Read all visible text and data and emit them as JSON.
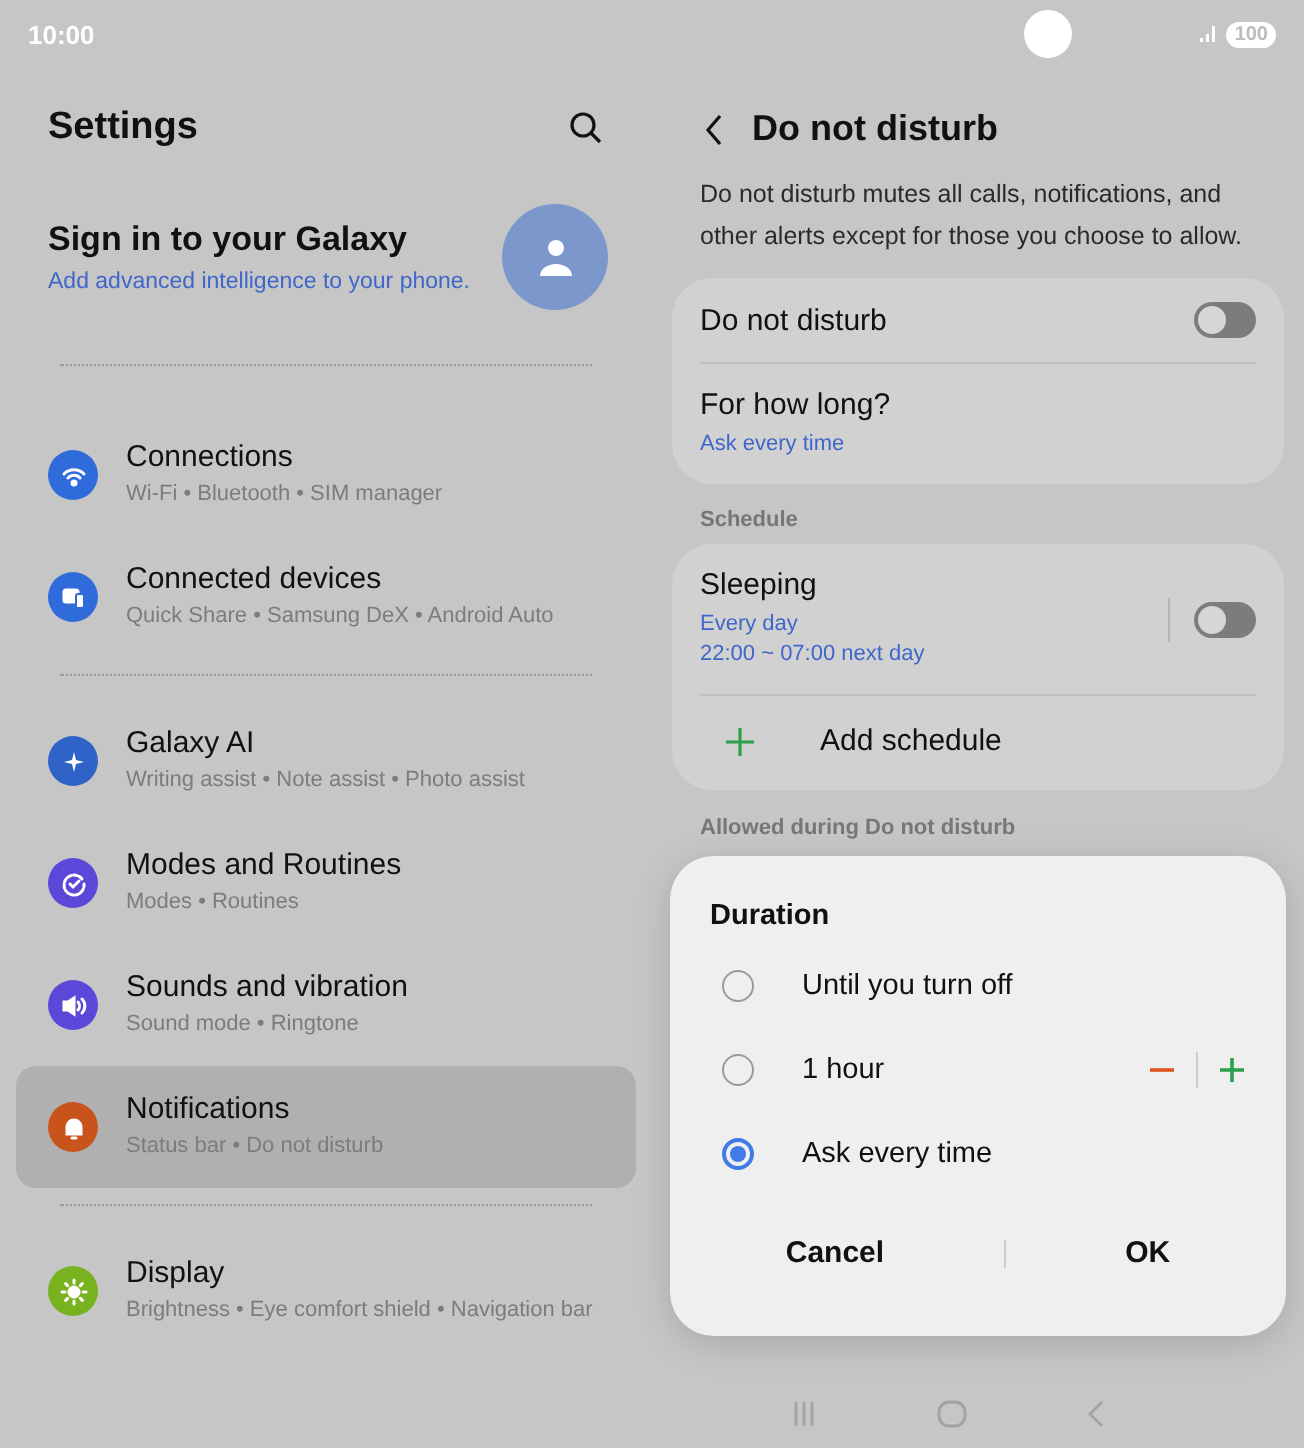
{
  "status_bar": {
    "time": "10:00",
    "battery": "100"
  },
  "settings": {
    "title": "Settings",
    "profile": {
      "title": "Sign in to your Galaxy",
      "subtitle": "Add advanced intelligence to your phone."
    },
    "groups": [
      {
        "items": [
          {
            "title": "Connections",
            "subtitle": "Wi-Fi • Bluetooth • SIM manager",
            "color": "#2f6bdb",
            "selected": false
          },
          {
            "title": "Connected devices",
            "subtitle": "Quick Share • Samsung DeX • Android Auto",
            "color": "#2f6bdb",
            "selected": false
          }
        ]
      },
      {
        "items": [
          {
            "title": "Galaxy AI",
            "subtitle": "Writing assist • Note assist • Photo assist",
            "color": "#2f63c8",
            "selected": false
          },
          {
            "title": "Modes and Routines",
            "subtitle": "Modes • Routines",
            "color": "#5b48d9",
            "selected": false
          },
          {
            "title": "Sounds and vibration",
            "subtitle": "Sound mode • Ringtone",
            "color": "#5b48d9",
            "selected": false
          },
          {
            "title": "Notifications",
            "subtitle": "Status bar • Do not disturb",
            "color": "#c9541b",
            "selected": true
          }
        ]
      },
      {
        "items": [
          {
            "title": "Display",
            "subtitle": "Brightness • Eye comfort shield • Navigation bar",
            "color": "#79b21f",
            "selected": false
          }
        ]
      }
    ]
  },
  "dnd": {
    "title": "Do not disturb",
    "description": "Do not disturb mutes all calls, notifications, and other alerts except for those you choose to allow.",
    "main_card": [
      {
        "kind": "toggle",
        "title": "Do not disturb",
        "on": false
      },
      {
        "kind": "detail",
        "title": "For how long?",
        "value": "Ask every time"
      }
    ],
    "schedule_label": "Schedule",
    "schedule_card": [
      {
        "kind": "schedule",
        "title": "Sleeping",
        "lines": [
          "Every day",
          "22:00 ~ 07:00 next day"
        ],
        "on": false
      },
      {
        "kind": "add",
        "title": "Add schedule"
      }
    ],
    "allowed_label": "Allowed during Do not disturb"
  },
  "dialog": {
    "title": "Duration",
    "options": [
      {
        "kind": "plain",
        "label": "Until you turn off",
        "selected": false
      },
      {
        "kind": "stepper",
        "label": "1 hour",
        "selected": false
      },
      {
        "kind": "plain",
        "label": "Ask every time",
        "selected": true
      }
    ],
    "buttons": [
      "Cancel",
      "OK"
    ]
  }
}
